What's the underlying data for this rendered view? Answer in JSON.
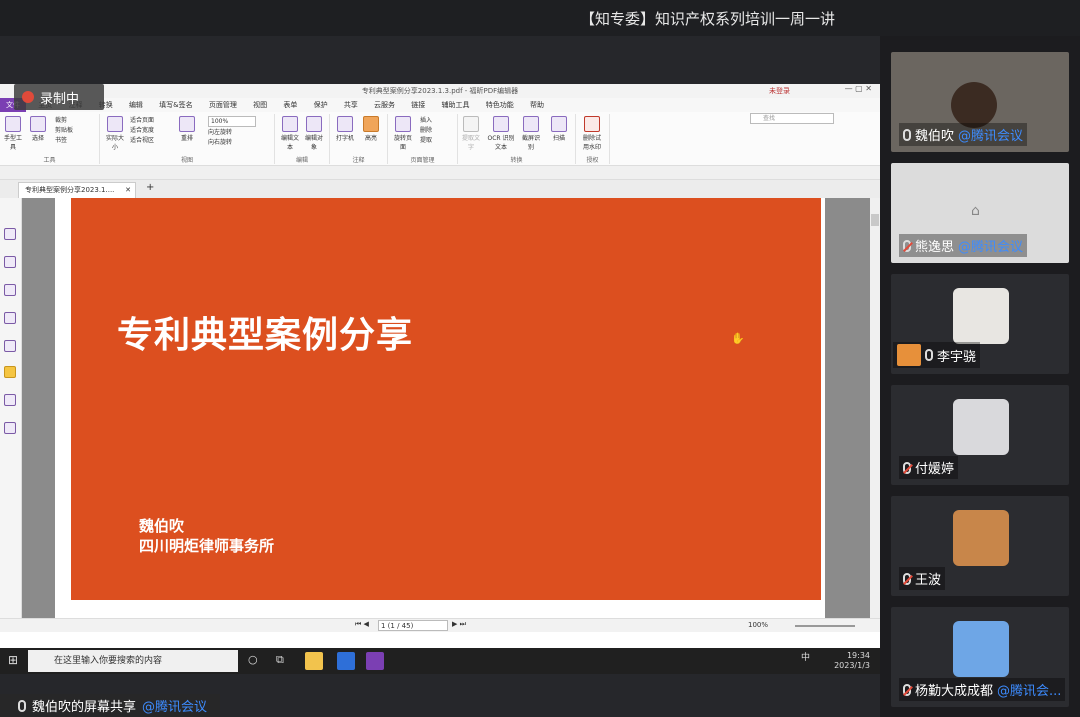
{
  "meeting": {
    "title": "【知专委】知识产权系列培训一周一讲"
  },
  "recording": {
    "label": "录制中"
  },
  "pdf": {
    "window_title": "专利典型案例分享2023.1.3.pdf - 福昕PDF编辑器",
    "login": "未登录",
    "search_placeholder": "查找",
    "menu": [
      "文件",
      "主页",
      "注释",
      "转换",
      "编辑",
      "填写&签名",
      "页面管理",
      "视图",
      "表单",
      "保护",
      "共享",
      "云服务",
      "链接",
      "辅助工具",
      "特色功能",
      "帮助"
    ],
    "ribbon": {
      "tool_group": "工具",
      "hand_tool": "手型工具",
      "select": "选择",
      "crop": "裁剪",
      "clipboard": "剪贴板",
      "bookmark": "书签",
      "actual_size": "实际大小",
      "fit_page": "适合页面",
      "fit_width": "适合宽度",
      "fit_view": "适合视区",
      "reflow": "重排",
      "zoom": "100%",
      "rotate_left": "向左旋转",
      "rotate_right": "向右旋转",
      "view_group": "视图",
      "edit_text": "编辑文本",
      "edit_object": "编辑对象",
      "edit_group": "编辑",
      "typewriter": "打字机",
      "highlight": "高亮",
      "annot_group": "注释",
      "rotate_page": "旋转页面",
      "insert": "插入",
      "delete": "删除",
      "extract": "提取",
      "page_group": "页面管理",
      "extract_text": "提取文字",
      "ocr": "OCR 识别文本",
      "screenshot": "截屏识别",
      "scan": "扫描",
      "convert_group": "转换",
      "remove_watermark": "删除试用水印",
      "license_group": "授权"
    },
    "tab_label": "专利典型案例分享2023.1....",
    "slide": {
      "title": "专利典型案例分享",
      "author": "魏伯吹",
      "firm": "四川明炬律师事务所"
    },
    "status": {
      "page_indicator": "1 (1 / 45)",
      "zoom": "100%"
    }
  },
  "taskbar": {
    "search_placeholder": "在这里输入你要搜索的内容",
    "ime": "中",
    "time": "19:34",
    "date": "2023/1/3"
  },
  "participants": [
    {
      "name": "魏伯吹",
      "org": "@腾讯会议",
      "muted": false,
      "video": true
    },
    {
      "name": "熊逸思",
      "org": "@腾讯会议",
      "muted": true,
      "video": false
    },
    {
      "name": "李宇骁",
      "org": "",
      "muted": false,
      "video": false
    },
    {
      "name": "付媛婷",
      "org": "",
      "muted": true,
      "video": false
    },
    {
      "name": "王波",
      "org": "",
      "muted": true,
      "video": false
    },
    {
      "name": "杨勤大成成都",
      "org": "@腾讯会...",
      "muted": true,
      "video": false
    }
  ],
  "share_label": {
    "text": "魏伯吹的屏幕共享",
    "org": "@腾讯会议"
  }
}
